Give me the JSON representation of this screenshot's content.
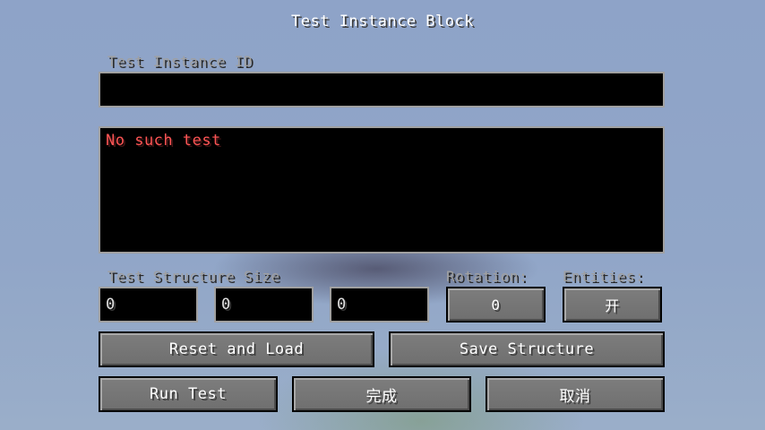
{
  "title": "Test Instance Block",
  "instance_id": {
    "label": "Test Instance ID",
    "value": ""
  },
  "status": {
    "message": "No such test",
    "color": "#ff5555"
  },
  "structure_size": {
    "label": "Test Structure Size",
    "x": "0",
    "y": "0",
    "z": "0"
  },
  "rotation": {
    "label": "Rotation:",
    "value": "0"
  },
  "entities": {
    "label": "Entities:",
    "value": "开"
  },
  "buttons": {
    "reset_and_load": "Reset and Load",
    "save_structure": "Save Structure",
    "run_test": "Run Test",
    "done": "完成",
    "cancel": "取消"
  }
}
